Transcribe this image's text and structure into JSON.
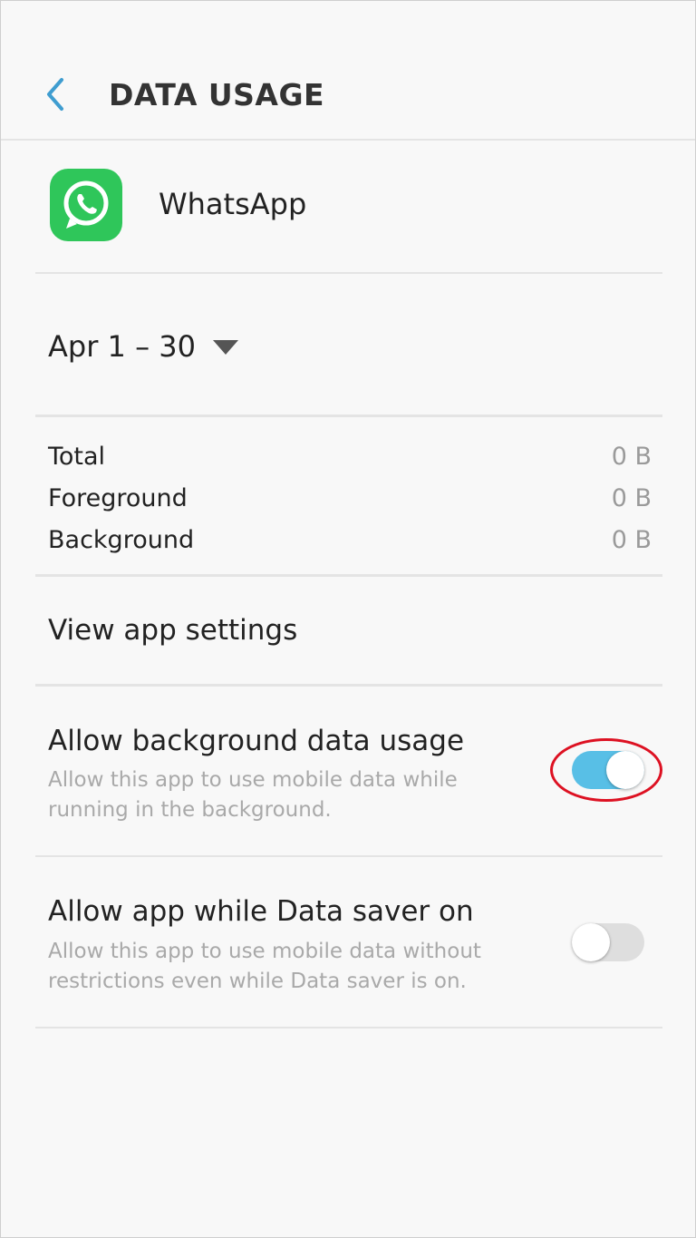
{
  "header": {
    "title": "DATA USAGE",
    "back_icon": "chevron-left-icon"
  },
  "app": {
    "name": "WhatsApp",
    "icon": "whatsapp-logo-icon"
  },
  "period": {
    "label": "Apr 1 – 30",
    "caret_icon": "caret-down-icon"
  },
  "usage": [
    {
      "label": "Total",
      "value": "0 B"
    },
    {
      "label": "Foreground",
      "value": "0 B"
    },
    {
      "label": "Background",
      "value": "0 B"
    }
  ],
  "view_settings_label": "View app settings",
  "toggles": [
    {
      "title": "Allow background data usage",
      "description": "Allow this app to use mobile data while running in the background.",
      "state": "on"
    },
    {
      "title": "Allow app while Data saver on",
      "description": "Allow this app to use mobile data without restrictions even while Data saver is on.",
      "state": "off"
    }
  ],
  "colors": {
    "accent": "#58bfe6",
    "back_arrow": "#3f9dd0",
    "whatsapp_green": "#2fc65a",
    "highlight_ring": "#dd1122"
  }
}
